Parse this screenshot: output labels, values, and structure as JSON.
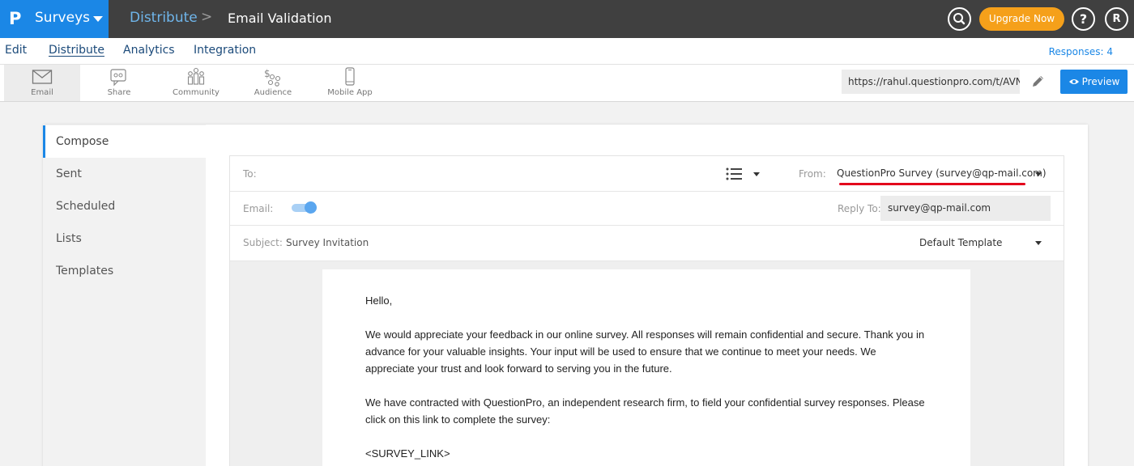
{
  "topbar": {
    "logo_glyph": "P",
    "product": "Surveys",
    "breadcrumb": [
      "Distribute",
      "Email Validation"
    ],
    "breadcrumb_sep": ">",
    "upgrade_label": "Upgrade Now",
    "help_label": "?",
    "user_initial": "R",
    "colors": {
      "bar": "#404040",
      "brand": "#1b87e6",
      "upgrade": "#f5a01a"
    }
  },
  "subnav": {
    "items": [
      {
        "label": "Edit",
        "active": false
      },
      {
        "label": "Distribute",
        "active": true
      },
      {
        "label": "Analytics",
        "active": false
      },
      {
        "label": "Integration",
        "active": false
      }
    ],
    "responses": "Responses: 4"
  },
  "toolbar": {
    "tools": [
      {
        "label": "Email",
        "icon": "envelope-icon",
        "active": true
      },
      {
        "label": "Share",
        "icon": "share-icon",
        "active": false
      },
      {
        "label": "Community",
        "icon": "community-icon",
        "active": false
      },
      {
        "label": "Audience",
        "icon": "audience-icon",
        "active": false
      },
      {
        "label": "Mobile App",
        "icon": "mobile-icon",
        "active": false
      }
    ],
    "url": "https://rahul.questionpro.com/t/AVN",
    "preview_label": "Preview"
  },
  "sidebar": {
    "items": [
      {
        "label": "Compose",
        "active": true
      },
      {
        "label": "Sent",
        "active": false
      },
      {
        "label": "Scheduled",
        "active": false
      },
      {
        "label": "Lists",
        "active": false
      },
      {
        "label": "Templates",
        "active": false
      }
    ]
  },
  "compose": {
    "to_label": "To:",
    "from_label": "From:",
    "from_value": "QuestionPro Survey (survey@qp-mail.com)",
    "email_label": "Email:",
    "email_toggle_on": true,
    "reply_to_label": "Reply To:",
    "reply_to_value": "survey@qp-mail.com",
    "subject_label": "Subject:",
    "subject_value": "Survey Invitation",
    "template_value": "Default Template",
    "highlight_color": "#e3001b"
  },
  "email_body": {
    "greeting": "Hello,",
    "paragraph1": "We would appreciate your feedback in our online survey. All responses will remain confidential and secure. Thank you in advance for your valuable insights. Your input will be used to ensure that we continue to meet your needs. We appreciate your trust and look forward to serving you in the future.",
    "paragraph2": "We have contracted with QuestionPro, an independent research firm, to field your confidential survey responses. Please click on this link to complete the survey:",
    "survey_link": "<SURVEY_LINK>"
  }
}
